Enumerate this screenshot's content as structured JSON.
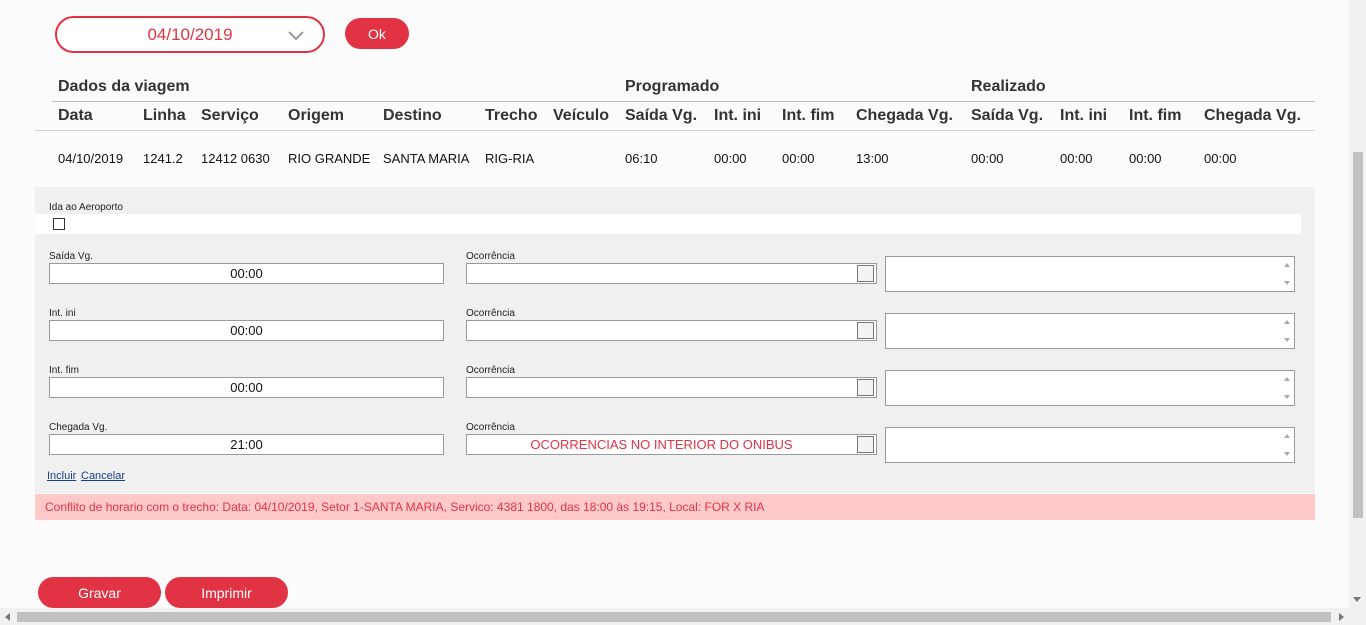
{
  "top": {
    "date_value": "04/10/2019",
    "ok_label": "Ok"
  },
  "table": {
    "groups": {
      "dados": "Dados da viagem",
      "programado": "Programado",
      "realizado": "Realizado"
    },
    "headers": [
      "Data",
      "Linha",
      "Serviço",
      "Origem",
      "Destino",
      "Trecho",
      "Veículo",
      "Saída Vg.",
      "Int. ini",
      "Int. fim",
      "Chegada Vg.",
      "Saída Vg.",
      "Int. ini",
      "Int. fim",
      "Chegada Vg."
    ],
    "row": [
      "04/10/2019",
      "1241.2",
      "12412 0630",
      "RIO GRANDE",
      "SANTA MARIA",
      "RIG-RIA",
      "",
      "06:10",
      "00:00",
      "00:00",
      "13:00",
      "00:00",
      "00:00",
      "00:00",
      "00:00"
    ]
  },
  "form": {
    "airport_label": "Ida ao Aeroporto",
    "occurrence_label": "Ocorrência",
    "fields": [
      {
        "label": "Saída Vg.",
        "time": "00:00",
        "occurrence": ""
      },
      {
        "label": "Int. ini",
        "time": "00:00",
        "occurrence": ""
      },
      {
        "label": "Int. fim",
        "time": "00:00",
        "occurrence": ""
      },
      {
        "label": "Chegada Vg.",
        "time": "21:00",
        "occurrence": "OCORRENCIAS NO INTERIOR DO ONIBUS"
      }
    ],
    "incluir_label": "Incluir",
    "cancelar_label": "Cancelar"
  },
  "error_message": "Conflito de horario com o trecho: Data: 04/10/2019, Setor 1-SANTA MARIA, Servico: 4381 1800, das 18:00 às 19:15, Local: FOR X RIA",
  "buttons": {
    "gravar": "Gravar",
    "imprimir": "Imprimir"
  },
  "colors": {
    "accent": "#e23344",
    "error_bg": "#ffc9c9",
    "panel_bg": "#f0f0f0"
  }
}
